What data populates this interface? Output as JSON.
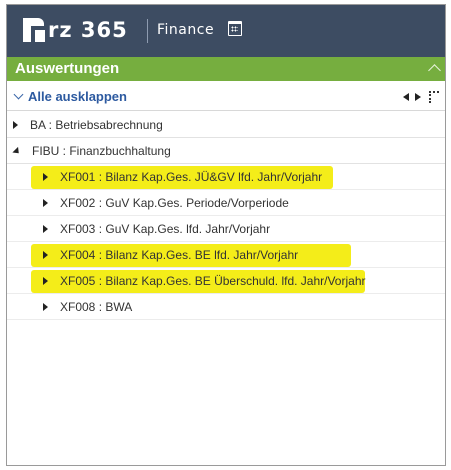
{
  "header": {
    "logo_text": "rz 365",
    "product_name": "Finance",
    "calendar_icon": "calendar-icon"
  },
  "section": {
    "title": "Auswertungen",
    "collapse_icon": "chevron-up-icon"
  },
  "toolbar": {
    "expand_all_label": "Alle ausklappen",
    "icons": [
      "chevron-down-icon",
      "nav-left-icon",
      "nav-right-icon",
      "expand-icon"
    ]
  },
  "tree": {
    "items": [
      {
        "label": "BA : Betriebsabrechnung",
        "expanded": false
      },
      {
        "label": "FIBU : Finanzbuchhaltung",
        "expanded": true,
        "children": [
          {
            "label": "XF001 : Bilanz Kap.Ges. JÜ&GV lfd. Jahr/Vorjahr",
            "highlighted": true
          },
          {
            "label": "XF002 : GuV Kap.Ges. Periode/Vorperiode",
            "highlighted": false
          },
          {
            "label": "XF003 : GuV Kap.Ges. lfd. Jahr/Vorjahr",
            "highlighted": false
          },
          {
            "label": "XF004 : Bilanz Kap.Ges. BE lfd. Jahr/Vorjahr",
            "highlighted": true
          },
          {
            "label": "XF005 : Bilanz Kap.Ges. BE Überschuld. lfd. Jahr/Vorjahr",
            "highlighted": true
          },
          {
            "label": "XF008 : BWA",
            "highlighted": false
          }
        ]
      }
    ]
  },
  "colors": {
    "header_bg": "#3d4c62",
    "section_bg": "#76ae3f",
    "link_blue": "#2d5aa0",
    "highlight": "#f4ed19"
  }
}
